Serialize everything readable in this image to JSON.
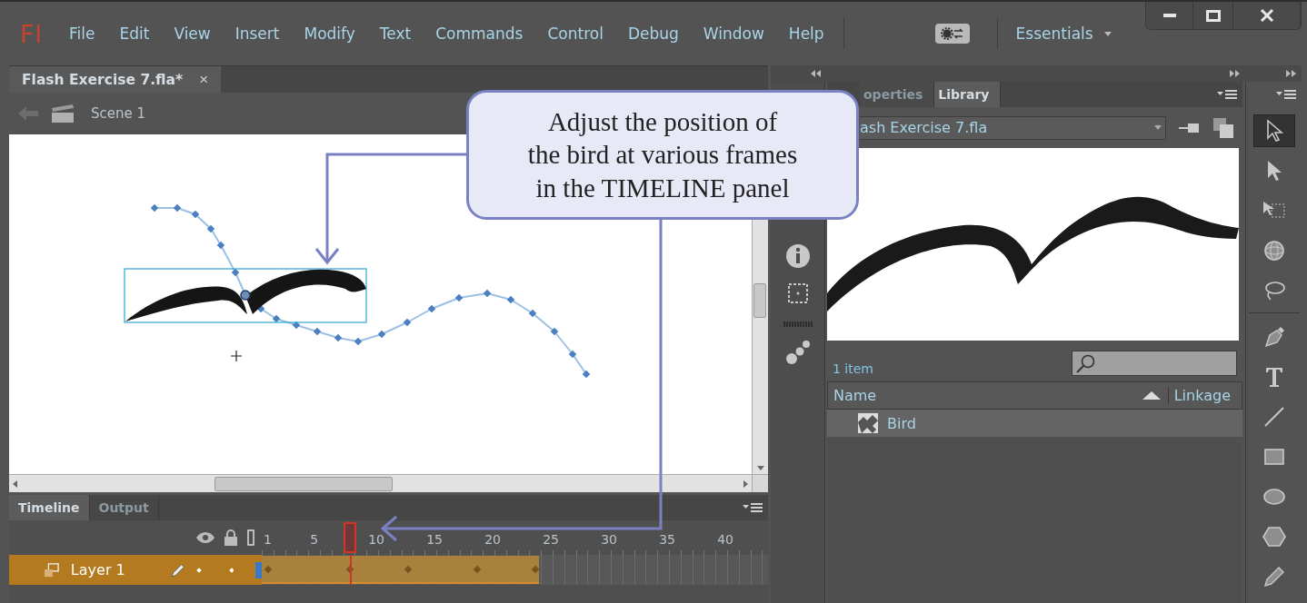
{
  "app": {
    "logo": "Fl"
  },
  "menu": [
    "File",
    "Edit",
    "View",
    "Insert",
    "Modify",
    "Text",
    "Commands",
    "Control",
    "Debug",
    "Window",
    "Help"
  ],
  "workspace": {
    "label": "Essentials"
  },
  "document_tab": {
    "title": "Flash Exercise 7.fla*",
    "close": "×"
  },
  "scene": {
    "label": "Scene 1"
  },
  "timeline": {
    "tabs": [
      {
        "label": "Timeline",
        "selected": true
      },
      {
        "label": "Output",
        "selected": false
      }
    ],
    "frame_numbers": [
      "1",
      "5",
      "10",
      "15",
      "20",
      "25",
      "30",
      "35",
      "40"
    ],
    "layers": [
      {
        "name": "Layer 1",
        "selected": true
      }
    ]
  },
  "panel_tabs": [
    {
      "label": "operties",
      "selected": false
    },
    {
      "label": "Library",
      "selected": true
    }
  ],
  "library": {
    "document": "ash Exercise 7.fla",
    "item_count": "1 item",
    "columns": [
      "Name",
      "Linkage"
    ],
    "items": [
      {
        "name": "Bird",
        "selected": true
      }
    ]
  },
  "tool_groups": [
    {
      "tools": [
        {
          "kind": "selection",
          "selected": true
        },
        {
          "kind": "subselection",
          "selected": false
        },
        {
          "kind": "free-transform",
          "selected": false
        },
        {
          "kind": "rotation-3d",
          "selected": false
        },
        {
          "kind": "lasso",
          "selected": false
        }
      ]
    },
    {
      "tools": [
        {
          "kind": "pen",
          "selected": false
        },
        {
          "kind": "text",
          "selected": false
        },
        {
          "kind": "line",
          "selected": false
        },
        {
          "kind": "rectangle",
          "selected": false
        },
        {
          "kind": "oval",
          "selected": false
        },
        {
          "kind": "polystar",
          "selected": false
        },
        {
          "kind": "pencil",
          "selected": false
        }
      ]
    }
  ],
  "callout": {
    "text": "Adjust the position of\nthe bird at various frames\nin the TIMELINE panel"
  }
}
